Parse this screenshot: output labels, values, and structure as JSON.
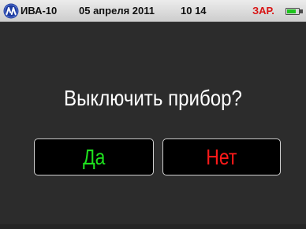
{
  "status_bar": {
    "device_name": "ИВА-10",
    "date": "05 апреля 2011",
    "time": "10 14",
    "charging_label": "ЗАР.",
    "logo_icon": "logo-badge-icon",
    "battery_icon": "battery-icon",
    "battery_level": 0.8
  },
  "dialog": {
    "question": "Выключить прибор?",
    "yes_label": "Да",
    "no_label": "Нет"
  },
  "colors": {
    "background": "#2c2c2c",
    "yes": "#1ee21e",
    "no": "#ff1a1a",
    "charging": "#d81414"
  }
}
